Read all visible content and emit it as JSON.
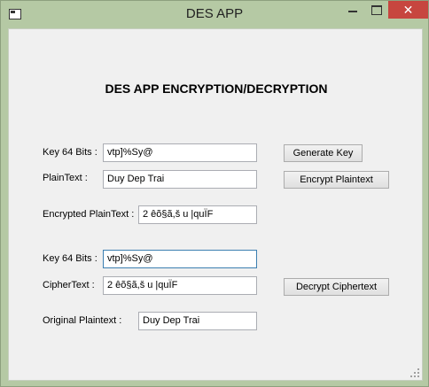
{
  "window": {
    "title": "DES APP",
    "close_glyph": "✕"
  },
  "main": {
    "heading": "DES APP ENCRYPTION/DECRYPTION"
  },
  "encrypt": {
    "key_label": "Key 64 Bits :",
    "key_value": "vtp]%Sy@",
    "plaintext_label": "PlainText :",
    "plaintext_value": "Duy Dep Trai",
    "encrypted_label": "Encrypted PlainText :",
    "encrypted_value": "2 êõ§ã,š u |quÏF",
    "generate_key_label": "Generate Key",
    "encrypt_plaintext_label": "Encrypt Plaintext"
  },
  "decrypt": {
    "key_label": "Key 64 Bits :",
    "key_value": "vtp]%Sy@",
    "ciphertext_label": "CipherText :",
    "ciphertext_value": "2 êõ§ã,š u |quÏF",
    "original_label": "Original Plaintext :",
    "original_value": "Duy Dep Trai",
    "decrypt_ciphertext_label": "Decrypt Ciphertext"
  }
}
